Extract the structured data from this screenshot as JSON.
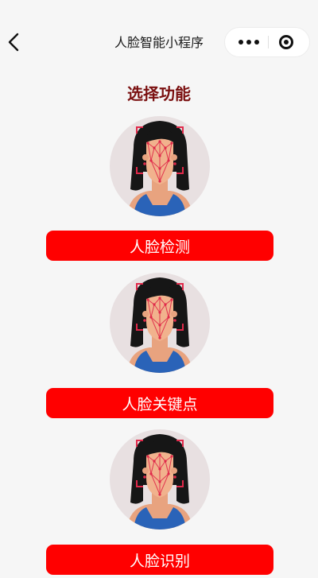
{
  "nav": {
    "title": "人脸智能小程序",
    "back_icon": "chevron-left-icon",
    "more_icon": "more-dots-icon",
    "close_icon": "target-circle-icon"
  },
  "page": {
    "heading": "选择功能"
  },
  "features": [
    {
      "label": "人脸检测",
      "image_icon": "face-landmark-illustration"
    },
    {
      "label": "人脸关键点",
      "image_icon": "face-landmark-illustration"
    },
    {
      "label": "人脸识别",
      "image_icon": "face-landmark-illustration"
    }
  ],
  "colors": {
    "accent_button": "#ff0000",
    "heading": "#7a0f0f",
    "background": "#f6f6f6"
  }
}
